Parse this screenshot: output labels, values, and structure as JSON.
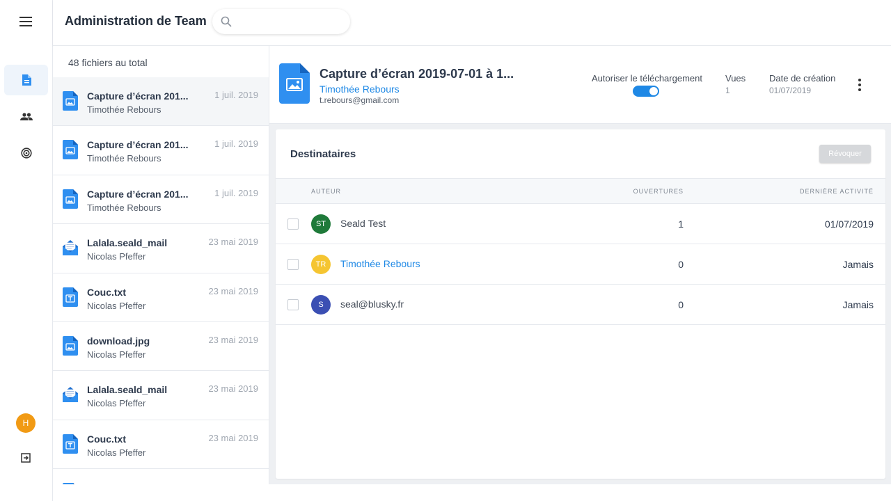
{
  "header": {
    "title": "Administration de Team",
    "search_placeholder": ""
  },
  "sidebar": {
    "items": [
      {
        "name": "files",
        "icon": "file-icon",
        "active": true
      },
      {
        "name": "users",
        "icon": "users-icon",
        "active": false
      },
      {
        "name": "activity",
        "icon": "radar-icon",
        "active": false
      }
    ],
    "user_initial": "H",
    "avatar_color": "#f19a14"
  },
  "file_list": {
    "total_label": "48 fichiers au total",
    "items": [
      {
        "name": "Capture d’écran 201...",
        "owner": "Timothée Rebours",
        "date": "1 juil. 2019",
        "type": "image",
        "selected": true
      },
      {
        "name": "Capture d’écran 201...",
        "owner": "Timothée Rebours",
        "date": "1 juil. 2019",
        "type": "image"
      },
      {
        "name": "Capture d’écran 201...",
        "owner": "Timothée Rebours",
        "date": "1 juil. 2019",
        "type": "image"
      },
      {
        "name": "Lalala.seald_mail",
        "owner": "Nicolas Pfeffer",
        "date": "23 mai 2019",
        "type": "mail"
      },
      {
        "name": "Couc.txt",
        "owner": "Nicolas Pfeffer",
        "date": "23 mai 2019",
        "type": "text"
      },
      {
        "name": "download.jpg",
        "owner": "Nicolas Pfeffer",
        "date": "23 mai 2019",
        "type": "image"
      },
      {
        "name": "Lalala.seald_mail",
        "owner": "Nicolas Pfeffer",
        "date": "23 mai 2019",
        "type": "mail"
      },
      {
        "name": "Couc.txt",
        "owner": "Nicolas Pfeffer",
        "date": "23 mai 2019",
        "type": "text"
      },
      {
        "name": "",
        "owner": "",
        "date": "",
        "type": "image"
      }
    ]
  },
  "detail": {
    "title": "Capture d’écran 2019-07-01 à 1...",
    "owner": "Timothée Rebours",
    "email": "t.rebours@gmail.com",
    "download_label": "Autoriser le téléchargement",
    "download_enabled": true,
    "views_label": "Vues",
    "views_value": "1",
    "created_label": "Date de création",
    "created_value": "01/07/2019"
  },
  "recipients": {
    "title": "Destinataires",
    "revoke_label": "Révoquer",
    "columns": {
      "author": "AUTEUR",
      "opens": "OUVERTURES",
      "last_activity": "DERNIÈRE ACTIVITÉ"
    },
    "rows": [
      {
        "initials": "ST",
        "name": "Seald Test",
        "opens": "1",
        "last": "01/07/2019",
        "color": "#1f7a3a",
        "link": false
      },
      {
        "initials": "TR",
        "name": "Timothée Rebours",
        "opens": "0",
        "last": "Jamais",
        "color": "#f5c531",
        "link": true
      },
      {
        "initials": "S",
        "name": "seal@blusky.fr",
        "opens": "0",
        "last": "Jamais",
        "color": "#3b4fb3",
        "link": false
      }
    ]
  },
  "colors": {
    "accent": "#1e88e5",
    "file_icon": "#2f8ff0"
  }
}
